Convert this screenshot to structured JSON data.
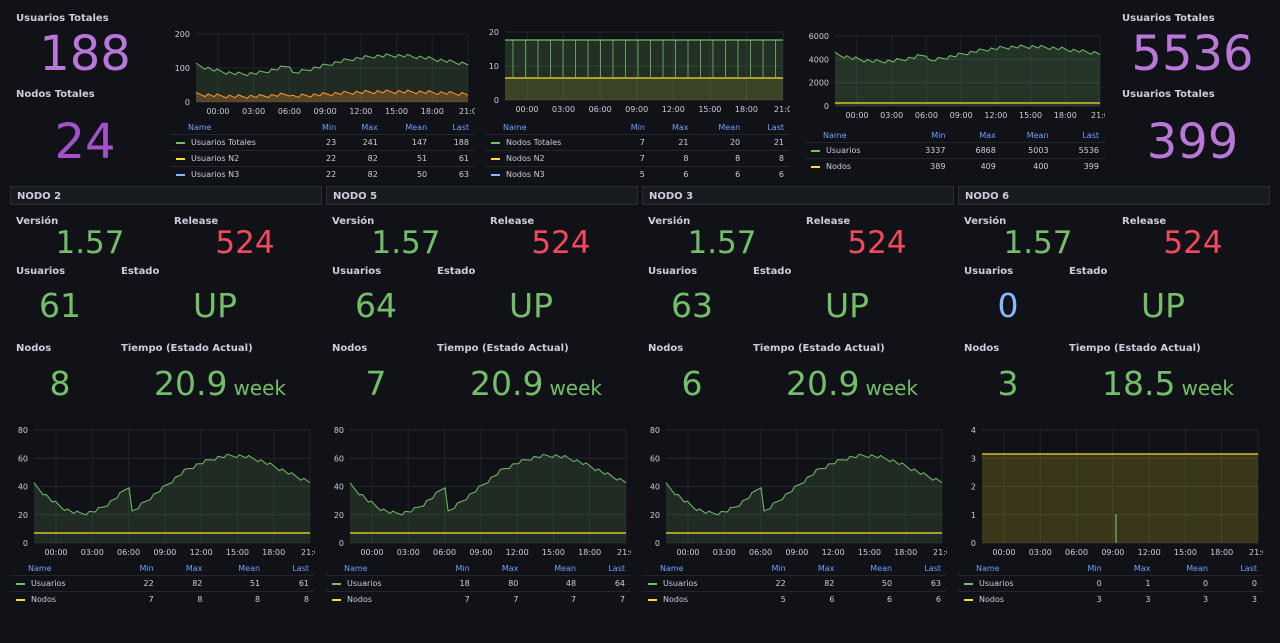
{
  "top": {
    "left_stats": [
      {
        "label": "Usuarios Totales",
        "value": "188"
      },
      {
        "label": "Nodos Totales",
        "value": "24"
      }
    ],
    "right_stats": [
      {
        "label": "Usuarios Totales",
        "value": "5536"
      },
      {
        "label": "Usuarios Totales",
        "value": "399"
      }
    ],
    "charts": [
      {
        "id": "users_by_node",
        "y_ticks": [
          "200",
          "100",
          "0"
        ],
        "x_ticks": [
          "00:00",
          "03:00",
          "06:00",
          "09:00",
          "12:00",
          "15:00",
          "18:00",
          "21:0"
        ],
        "legend_headers": [
          "Name",
          "Min",
          "Max",
          "Mean",
          "Last"
        ],
        "rows": [
          {
            "name": "Usuarios Totales",
            "color": "#73bf69",
            "min": "23",
            "max": "241",
            "mean": "147",
            "last": "188"
          },
          {
            "name": "Usuarios N2",
            "color": "#fade2a",
            "min": "22",
            "max": "82",
            "mean": "51",
            "last": "61"
          },
          {
            "name": "Usuarios N3",
            "color": "#8ab8ff",
            "min": "22",
            "max": "82",
            "mean": "50",
            "last": "63"
          }
        ]
      },
      {
        "id": "nodes_total",
        "y_ticks": [
          "20",
          "10",
          "0"
        ],
        "x_ticks": [
          "00:00",
          "03:00",
          "06:00",
          "09:00",
          "12:00",
          "15:00",
          "18:00",
          "21:0"
        ],
        "legend_headers": [
          "Name",
          "Min",
          "Max",
          "Mean",
          "Last"
        ],
        "rows": [
          {
            "name": "Nodos Totales",
            "color": "#73bf69",
            "min": "7",
            "max": "21",
            "mean": "20",
            "last": "21"
          },
          {
            "name": "Nodos N2",
            "color": "#fade2a",
            "min": "7",
            "max": "8",
            "mean": "8",
            "last": "8"
          },
          {
            "name": "Nodos N3",
            "color": "#8ab8ff",
            "min": "5",
            "max": "6",
            "mean": "6",
            "last": "6"
          }
        ]
      },
      {
        "id": "global",
        "y_ticks": [
          "6000",
          "4000",
          "2000",
          "0"
        ],
        "x_ticks": [
          "00:00",
          "03:00",
          "06:00",
          "09:00",
          "12:00",
          "15:00",
          "18:00",
          "21:0"
        ],
        "legend_headers": [
          "Name",
          "Min",
          "Max",
          "Mean",
          "Last"
        ],
        "rows": [
          {
            "name": "Usuarios",
            "color": "#73bf69",
            "min": "3337",
            "max": "6868",
            "mean": "5003",
            "last": "5536"
          },
          {
            "name": "Nodos",
            "color": "#fade2a",
            "min": "389",
            "max": "409",
            "mean": "400",
            "last": "399"
          }
        ]
      }
    ]
  },
  "nodes": [
    {
      "row_title": "NODO 2",
      "version_label": "Versión",
      "version": "1.57",
      "release_label": "Release",
      "release": "524",
      "users_label": "Usuarios",
      "users": "61",
      "state_label": "Estado",
      "state": "UP",
      "nodes_label": "Nodos",
      "nodes": "8",
      "time_label": "Tiempo (Estado Actual)",
      "time": "20.9",
      "time_unit": "week",
      "y_ticks": [
        "80",
        "60",
        "40",
        "20",
        "0"
      ],
      "x_ticks": [
        "00:00",
        "03:00",
        "06:00",
        "09:00",
        "12:00",
        "15:00",
        "18:00",
        "21:0"
      ],
      "legend_headers": [
        "Name",
        "Min",
        "Max",
        "Mean",
        "Last"
      ],
      "rows": [
        {
          "name": "Usuarios",
          "color": "#73bf69",
          "min": "22",
          "max": "82",
          "mean": "51",
          "last": "61"
        },
        {
          "name": "Nodos",
          "color": "#fade2a",
          "min": "7",
          "max": "8",
          "mean": "8",
          "last": "8"
        }
      ]
    },
    {
      "row_title": "NODO 5",
      "version_label": "Versión",
      "version": "1.57",
      "release_label": "Release",
      "release": "524",
      "users_label": "Usuarios",
      "users": "64",
      "state_label": "Estado",
      "state": "UP",
      "nodes_label": "Nodos",
      "nodes": "7",
      "time_label": "Tiempo (Estado Actual)",
      "time": "20.9",
      "time_unit": "week",
      "y_ticks": [
        "80",
        "60",
        "40",
        "20",
        "0"
      ],
      "x_ticks": [
        "00:00",
        "03:00",
        "06:00",
        "09:00",
        "12:00",
        "15:00",
        "18:00",
        "21:0"
      ],
      "legend_headers": [
        "Name",
        "Min",
        "Max",
        "Mean",
        "Last"
      ],
      "rows": [
        {
          "name": "Usuarios",
          "color": "#73bf69",
          "min": "18",
          "max": "80",
          "mean": "48",
          "last": "64"
        },
        {
          "name": "Nodos",
          "color": "#fade2a",
          "min": "7",
          "max": "7",
          "mean": "7",
          "last": "7"
        }
      ]
    },
    {
      "row_title": "NODO 3",
      "version_label": "Versión",
      "version": "1.57",
      "release_label": "Release",
      "release": "524",
      "users_label": "Usuarios",
      "users": "63",
      "state_label": "Estado",
      "state": "UP",
      "nodes_label": "Nodos",
      "nodes": "6",
      "time_label": "Tiempo (Estado Actual)",
      "time": "20.9",
      "time_unit": "week",
      "y_ticks": [
        "80",
        "60",
        "40",
        "20",
        "0"
      ],
      "x_ticks": [
        "00:00",
        "03:00",
        "06:00",
        "09:00",
        "12:00",
        "15:00",
        "18:00",
        "21:0"
      ],
      "legend_headers": [
        "Name",
        "Min",
        "Max",
        "Mean",
        "Last"
      ],
      "rows": [
        {
          "name": "Usuarios",
          "color": "#73bf69",
          "min": "22",
          "max": "82",
          "mean": "50",
          "last": "63"
        },
        {
          "name": "Nodos",
          "color": "#fade2a",
          "min": "5",
          "max": "6",
          "mean": "6",
          "last": "6"
        }
      ]
    },
    {
      "row_title": "NODO 6",
      "version_label": "Versión",
      "version": "1.57",
      "release_label": "Release",
      "release": "524",
      "users_label": "Usuarios",
      "users": "0",
      "state_label": "Estado",
      "state": "UP",
      "nodes_label": "Nodos",
      "nodes": "3",
      "time_label": "Tiempo (Estado Actual)",
      "time": "18.5",
      "time_unit": "week",
      "y_ticks": [
        "4",
        "3",
        "2",
        "1",
        "0"
      ],
      "x_ticks": [
        "00:00",
        "03:00",
        "06:00",
        "09:00",
        "12:00",
        "15:00",
        "18:00",
        "21:0"
      ],
      "legend_headers": [
        "Name",
        "Min",
        "Max",
        "Mean",
        "Last"
      ],
      "rows": [
        {
          "name": "Usuarios",
          "color": "#73bf69",
          "min": "0",
          "max": "1",
          "mean": "0",
          "last": "0"
        },
        {
          "name": "Nodos",
          "color": "#fade2a",
          "min": "3",
          "max": "3",
          "mean": "3",
          "last": "3"
        }
      ]
    }
  ],
  "colors": {
    "green": "#73bf69",
    "yellow": "#fade2a",
    "blue": "#8ab8ff",
    "purple": "#b877d9",
    "red": "#f2495c"
  }
}
